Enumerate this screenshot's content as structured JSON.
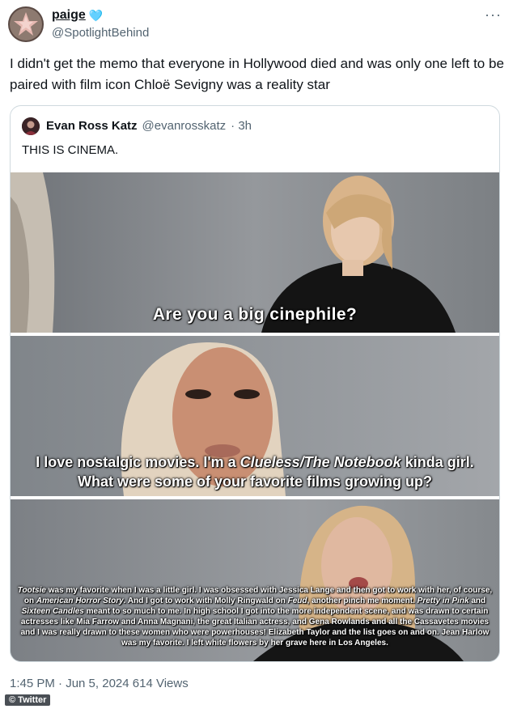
{
  "author": {
    "display_name": "paige",
    "name_emoji": "🩵",
    "handle": "@SpotlightBehind",
    "avatar_icon": "star-avatar-icon"
  },
  "more_label": "···",
  "tweet_text": "I didn't get the memo that everyone in Hollywood died and was only one left to be paired with film icon Chloë Sevigny was a reality star",
  "quote": {
    "display_name": "Evan Ross Katz",
    "handle": "@evanrosskatz",
    "time": "· 3h",
    "text": "THIS IS CINEMA.",
    "captions": {
      "frame1": "Are you a big cinephile?",
      "frame2_a": "I love nostalgic movies. I'm a ",
      "frame2_b": "Clueless/The Notebook",
      "frame2_c": " kinda girl. What were some of your favorite films growing up?",
      "frame3_a": "Tootsie",
      "frame3_b": " was my favorite when I was a little girl. I was obsessed with Jessica Lange and then got to work with her, of course, on ",
      "frame3_c": "American Horror Story",
      "frame3_d": ". And I got to work with Molly Ringwald on ",
      "frame3_e": "Feud",
      "frame3_f": ", another pinch me moment. ",
      "frame3_g": "Pretty in Pink",
      "frame3_h": " and ",
      "frame3_i": "Sixteen Candles",
      "frame3_j": " meant to so much to me. In high school I got into the more independent scene, and was drawn to certain actresses like Mia Farrow and Anna Magnani, the great Italian actress, and Gena Rowlands and all the Cassavetes movies and I was really drawn to these women who were powerhouses! Elizabeth Taylor and the list goes on and on. Jean Harlow was my favorite. I left white flowers by her grave here in Los Angeles."
    }
  },
  "footer": {
    "time": "1:45 PM · Jun 5, 2024",
    "views": "614",
    "views_label": "Views"
  },
  "watermark": "© Twitter",
  "colors": {
    "text": "#0f1419",
    "muted": "#536471",
    "border": "#cfd9de",
    "accent": "#1d9bf0"
  }
}
